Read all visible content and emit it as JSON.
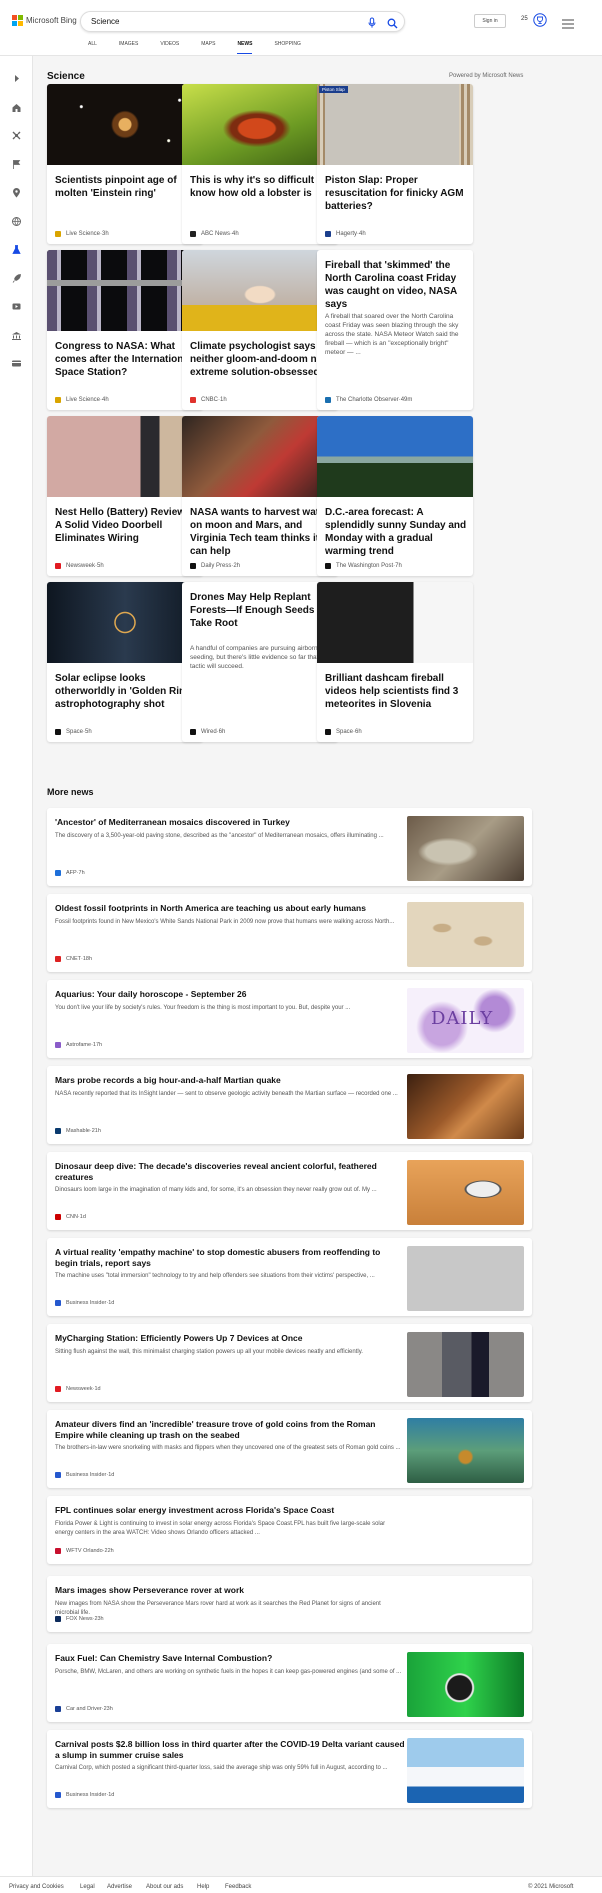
{
  "brand": {
    "name": "Microsoft Bing",
    "logo_colors": [
      "#f25022",
      "#7fba00",
      "#00a4ef",
      "#ffb900"
    ]
  },
  "search": {
    "query": "Science"
  },
  "tabs": [
    "ALL",
    "IMAGES",
    "VIDEOS",
    "MAPS",
    "NEWS",
    "SHOPPING"
  ],
  "active_tab": "NEWS",
  "header": {
    "signin": "Sign in",
    "points": "25"
  },
  "colors": {
    "accent": "#174ae4"
  },
  "rail_icons": [
    "chevron-right-icon",
    "home-icon",
    "satellite-icon",
    "flag-icon",
    "location-pin-icon",
    "globe-icon",
    "flask-icon",
    "rocket-icon",
    "video-icon",
    "bank-icon",
    "card-icon"
  ],
  "section": {
    "title": "Science",
    "powered": "Powered by Microsoft News"
  },
  "cards": [
    {
      "title": "Scientists pinpoint age of molten 'Einstein ring'",
      "source": "Live Science",
      "time": "3h"
    },
    {
      "title": "This is why it's so difficult to know how old a lobster is",
      "source": "ABC News",
      "time": "4h"
    },
    {
      "title": "Piston Slap: Proper resuscitation for finicky AGM batteries?",
      "source": "Hagerty",
      "time": "4h",
      "badge": "Piston Slap"
    },
    {
      "title": "Congress to NASA: What comes after the International Space Station?",
      "source": "Live Science",
      "time": "4h"
    },
    {
      "title": "Climate psychologist says neither gloom-and-doom nor extreme solution-obsessed…",
      "source": "CNBC",
      "time": "1h"
    },
    {
      "title": "Fireball that 'skimmed' the North Carolina coast Friday was caught on video, NASA says",
      "description": "A fireball that soared over the North Carolina coast Friday was seen blazing through the sky across the state. NASA Meteor Watch said the fireball — which is an \"exceptionally bright\" meteor — ...",
      "source": "The Charlotte Observer",
      "time": "49m"
    },
    {
      "title": "Nest Hello (Battery) Review: A Solid Video Doorbell Eliminates Wiring",
      "source": "Newsweek",
      "time": "5h"
    },
    {
      "title": "NASA wants to harvest water on moon and Mars, and Virginia Tech team thinks it can help",
      "source": "Daily Press",
      "time": "2h"
    },
    {
      "title": "D.C.-area forecast: A splendidly sunny Sunday and Monday with a gradual warming trend",
      "source": "The Washington Post",
      "time": "7h"
    },
    {
      "title": "Solar eclipse looks otherworldly in 'Golden Ring' astrophotography shot",
      "source": "Space",
      "time": "5h"
    },
    {
      "title": "Drones May Help Replant Forests—If Enough Seeds Take Root",
      "description": "A handful of companies are pursuing airborne seeding, but there's little evidence so far that the tactic will succeed.",
      "source": "Wired",
      "time": "6h"
    },
    {
      "title": "Brilliant dashcam fireball videos help scientists find 3 meteorites in Slovenia",
      "source": "Space",
      "time": "6h"
    }
  ],
  "more": {
    "title": "More news"
  },
  "rows": [
    {
      "title": "'Ancestor' of Mediterranean mosaics discovered in Turkey",
      "description": "The discovery of a 3,500-year-old paving stone, described as the \"ancestor\" of Mediterranean mosaics, offers illuminating ...",
      "source": "AFP",
      "time": "7h"
    },
    {
      "title": "Oldest fossil footprints in North America are teaching us about early humans",
      "description": "Fossil footprints found in New Mexico's White Sands National Park in 2009 now prove that humans were walking across North...",
      "source": "CNET",
      "time": "18h"
    },
    {
      "title": "Aquarius: Your daily horoscope - September 26",
      "description": "You don't live your life by society's rules. Your freedom is the thing is most important to you. But, despite your ...",
      "source": "Astrofame",
      "time": "17h",
      "image_text": "DAILY"
    },
    {
      "title": "Mars probe records a big hour-and-a-half Martian quake",
      "description": "NASA recently reported that its InSight lander — sent to observe geologic activity beneath the Martian surface — recorded one ...",
      "source": "Mashable",
      "time": "21h"
    },
    {
      "title": "Dinosaur deep dive: The decade's discoveries reveal ancient colorful, feathered creatures",
      "description": "Dinosaurs loom large in the imagination of many kids and, for some, it's an obsession they never really grow out of. My ...",
      "source": "CNN",
      "time": "1d"
    },
    {
      "title": "A virtual reality 'empathy machine' to stop domestic abusers from reoffending to begin trials, report says",
      "description": "The machine uses \"total immersion\" technology to try and help offenders see situations from their victims' perspective, ...",
      "source": "Business Insider",
      "time": "1d"
    },
    {
      "title": "MyCharging Station: Efficiently Powers Up 7 Devices at Once",
      "description": "Sitting flush against the wall, this minimalist charging station powers up all your mobile devices neatly and efficiently.",
      "source": "Newsweek",
      "time": "1d"
    },
    {
      "title": "Amateur divers find an 'incredible' treasure trove of gold coins from the Roman Empire while cleaning up trash on the seabed",
      "description": "The brothers-in-law were snorkeling with masks and flippers when they uncovered one of the greatest sets of Roman gold coins ...",
      "source": "Business Insider",
      "time": "1d"
    },
    {
      "title": "FPL continues solar energy investment across Florida's Space Coast",
      "description": "Florida Power & Light is continuing to invest in solar energy across Florida's Space Coast.FPL has built five large-scale solar energy centers in the area WATCH: Video shows Orlando officers attacked ...",
      "source": "WFTV Orlando",
      "time": "22h"
    },
    {
      "title": "Mars images show Perseverance rover at work",
      "description": "New images from NASA show the Perseverance Mars rover hard at work as it searches the Red Planet for signs of ancient microbial life.",
      "source": "FOX News",
      "time": "23h"
    },
    {
      "title": "Faux Fuel: Can Chemistry Save Internal Combustion?",
      "description": "Porsche, BMW, McLaren, and others are working on synthetic fuels in the hopes it can keep gas-powered engines (and some of ...",
      "source": "Car and Driver",
      "time": "23h"
    },
    {
      "title": "Carnival posts $2.8 billion loss in third quarter after the COVID-19 Delta variant caused a slump in summer cruise sales",
      "description": "Carnival Corp, which posted a significant third-quarter loss, said the average ship was only 59% full in August, according to ...",
      "source": "Business Insider",
      "time": "1d"
    }
  ],
  "footer": {
    "links": [
      "Privacy and Cookies",
      "Legal",
      "Advertise",
      "About our ads",
      "Help",
      "Feedback"
    ],
    "copyright": "© 2021 Microsoft"
  }
}
